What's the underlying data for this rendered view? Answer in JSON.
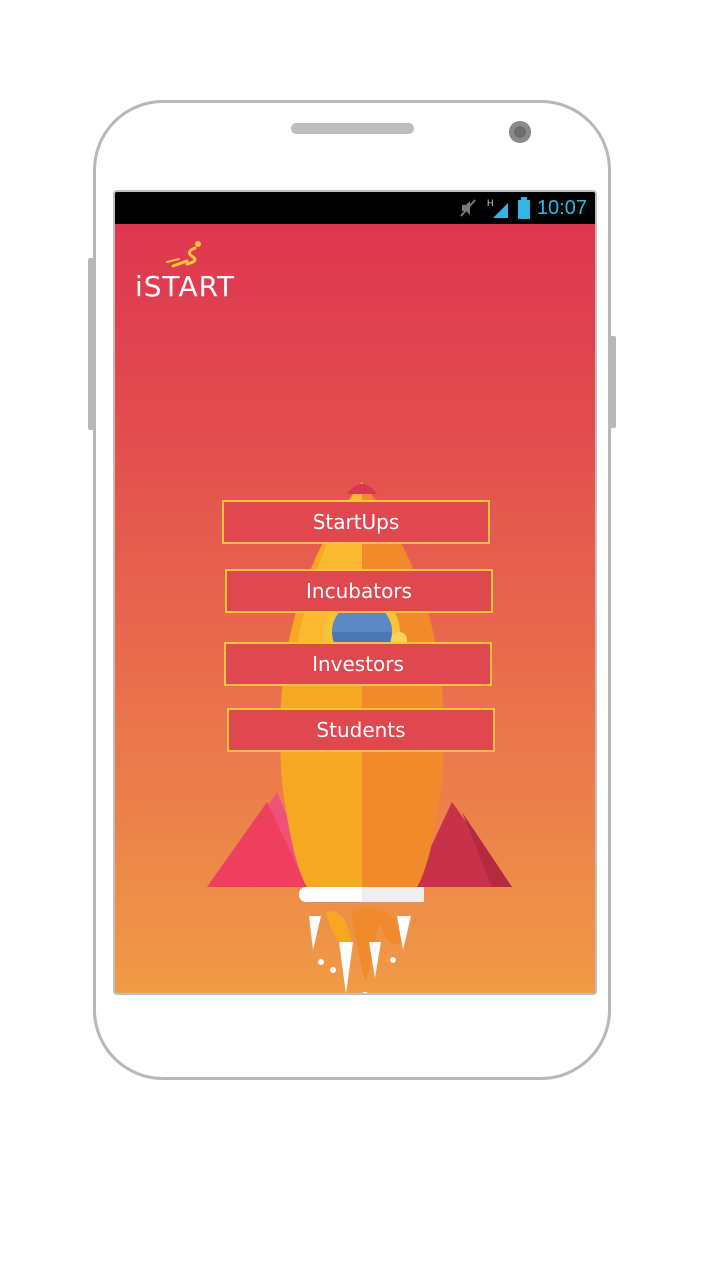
{
  "status_bar": {
    "time": "10:07",
    "icons": [
      "mute-icon",
      "signal-h-icon",
      "battery-icon"
    ],
    "time_color": "#33b5e5"
  },
  "app": {
    "logo_text": "iSTART",
    "logo_accent_color": "#f5c43a"
  },
  "menu": {
    "startups_label": "StartUps",
    "incubators_label": "Incubators",
    "investors_label": "Investors",
    "students_label": "Students"
  },
  "colors": {
    "gradient_top": "#de3350",
    "gradient_bottom": "#f09b46",
    "button_fill": "#e04850",
    "button_border": "#f5c43a"
  }
}
